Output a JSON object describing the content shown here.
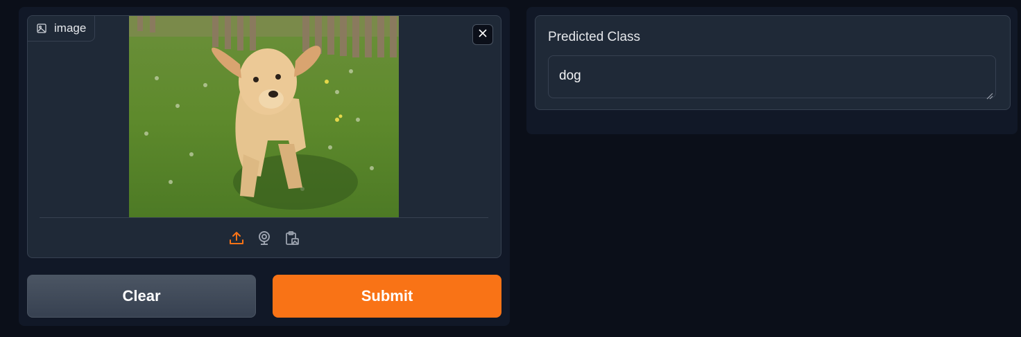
{
  "input": {
    "label": "image",
    "photo_description_icon": "dog-photo",
    "close_icon": "close-icon",
    "sources": [
      {
        "name": "upload-icon",
        "active": true
      },
      {
        "name": "webcam-icon",
        "active": false
      },
      {
        "name": "clipboard-icon",
        "active": false
      }
    ]
  },
  "buttons": {
    "clear_label": "Clear",
    "submit_label": "Submit"
  },
  "output": {
    "label": "Predicted Class",
    "value": "dog"
  },
  "colors": {
    "accent": "#f97316",
    "background": "#0b0f19",
    "panel": "#111827",
    "block": "#1f2937",
    "border": "#374151"
  }
}
